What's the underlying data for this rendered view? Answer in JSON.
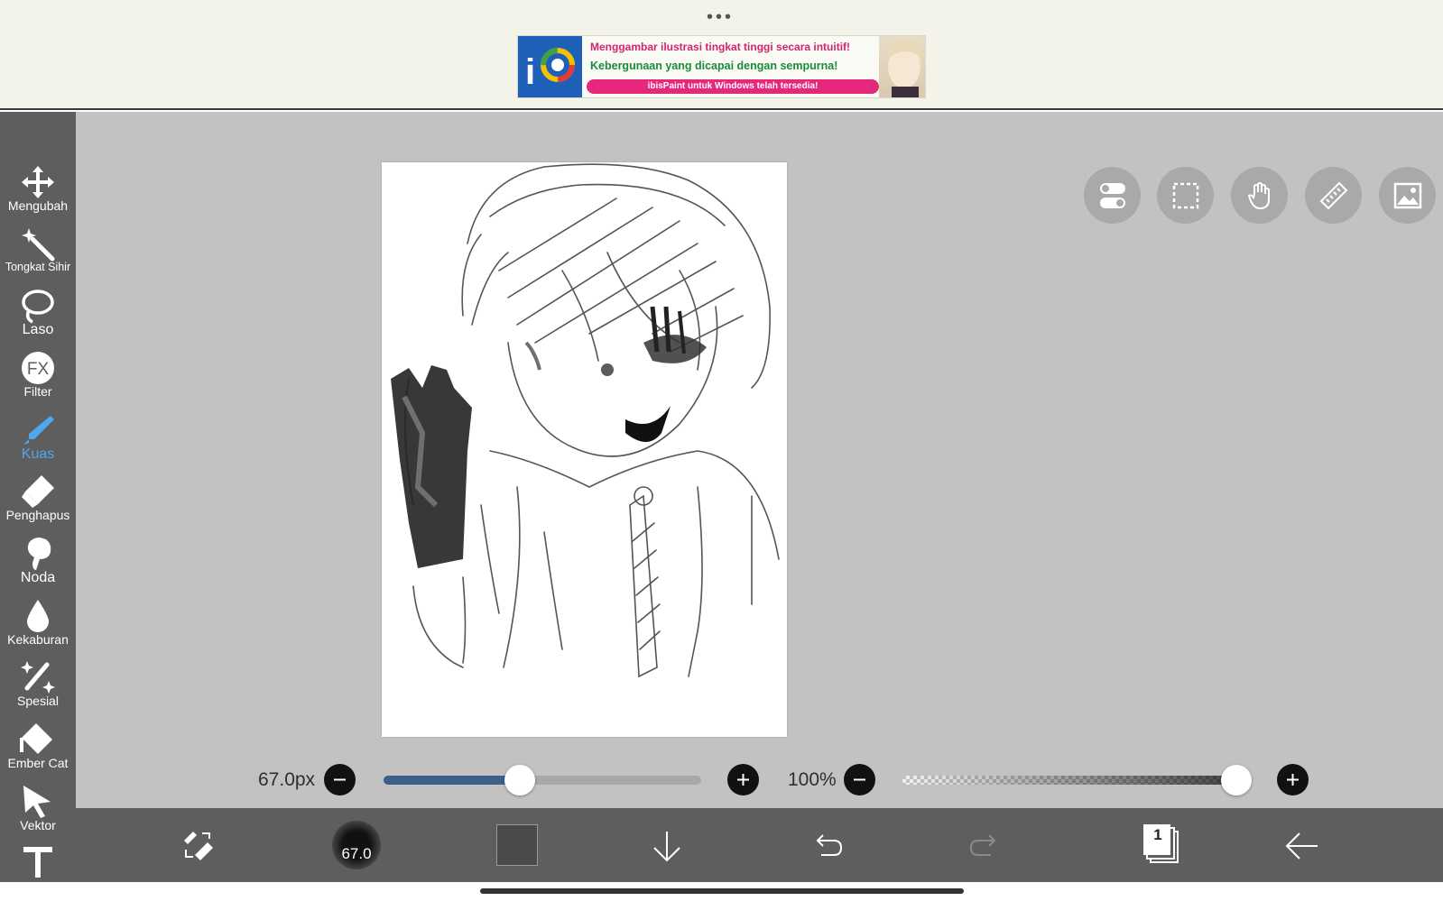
{
  "ad": {
    "line1": "Menggambar ilustrasi tingkat tinggi secara intuitif!",
    "line2": "Kebergunaan yang dicapai dengan sempurna!",
    "line3": "ibisPaint untuk Windows telah tersedia!"
  },
  "tools": [
    {
      "label": "Mengubah",
      "icon": "move-icon"
    },
    {
      "label": "Tongkat Sihir",
      "icon": "magic-wand-icon"
    },
    {
      "label": "Laso",
      "icon": "lasso-icon"
    },
    {
      "label": "Filter",
      "icon": "fx-icon"
    },
    {
      "label": "Kuas",
      "icon": "brush-icon",
      "active": true
    },
    {
      "label": "Penghapus",
      "icon": "eraser-icon"
    },
    {
      "label": "Noda",
      "icon": "smudge-icon"
    },
    {
      "label": "Kekaburan",
      "icon": "blur-drop-icon"
    },
    {
      "label": "Spesial",
      "icon": "special-wand-icon"
    },
    {
      "label": "Ember Cat",
      "icon": "paint-bucket-icon"
    },
    {
      "label": "Vektor",
      "icon": "vector-arrow-icon"
    },
    {
      "label": "",
      "icon": "text-icon"
    }
  ],
  "controls": {
    "brush_size_label": "67.0px",
    "brush_size_fraction": 0.43,
    "opacity_label": "100%",
    "opacity_fraction": 1.0
  },
  "bottom": {
    "brush_size_preview": "67.0",
    "layer_number": "1"
  },
  "colors": {
    "accent": "#4fa6ee",
    "slider_fill": "#3b5f87",
    "toolbar_bg": "#5e5e5e",
    "workspace_bg": "#c2c2c2",
    "current_color": "#4a4a4a"
  }
}
